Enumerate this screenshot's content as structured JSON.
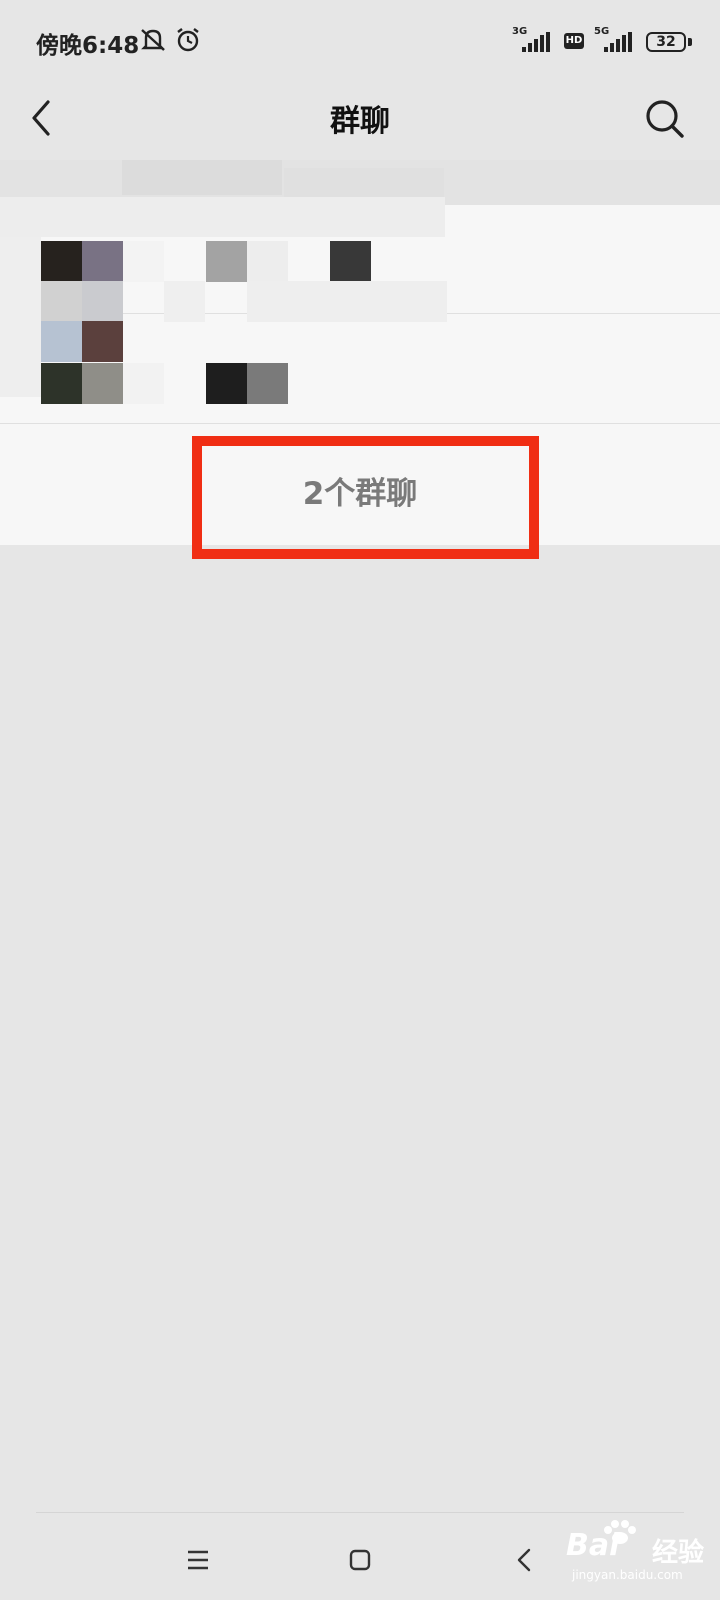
{
  "status_bar": {
    "time": "傍晚6:48",
    "network_1": "3G",
    "hd_badge": "HD",
    "network_2": "5G",
    "battery": "32",
    "icons": [
      "mute-icon",
      "alarm-icon",
      "signal-icon",
      "battery-icon"
    ]
  },
  "header": {
    "title": "群聊",
    "back_icon": "chevron-left-icon",
    "search_icon": "search-icon"
  },
  "group_list": {
    "count_label": "2个群聊",
    "highlight_color": "#f02e14"
  },
  "system_nav": {
    "items": [
      "menu-icon",
      "home-icon",
      "back-icon"
    ]
  },
  "watermark": {
    "brand": "Bai",
    "suffix": "经验",
    "url": "jingyan.baidu.com"
  }
}
